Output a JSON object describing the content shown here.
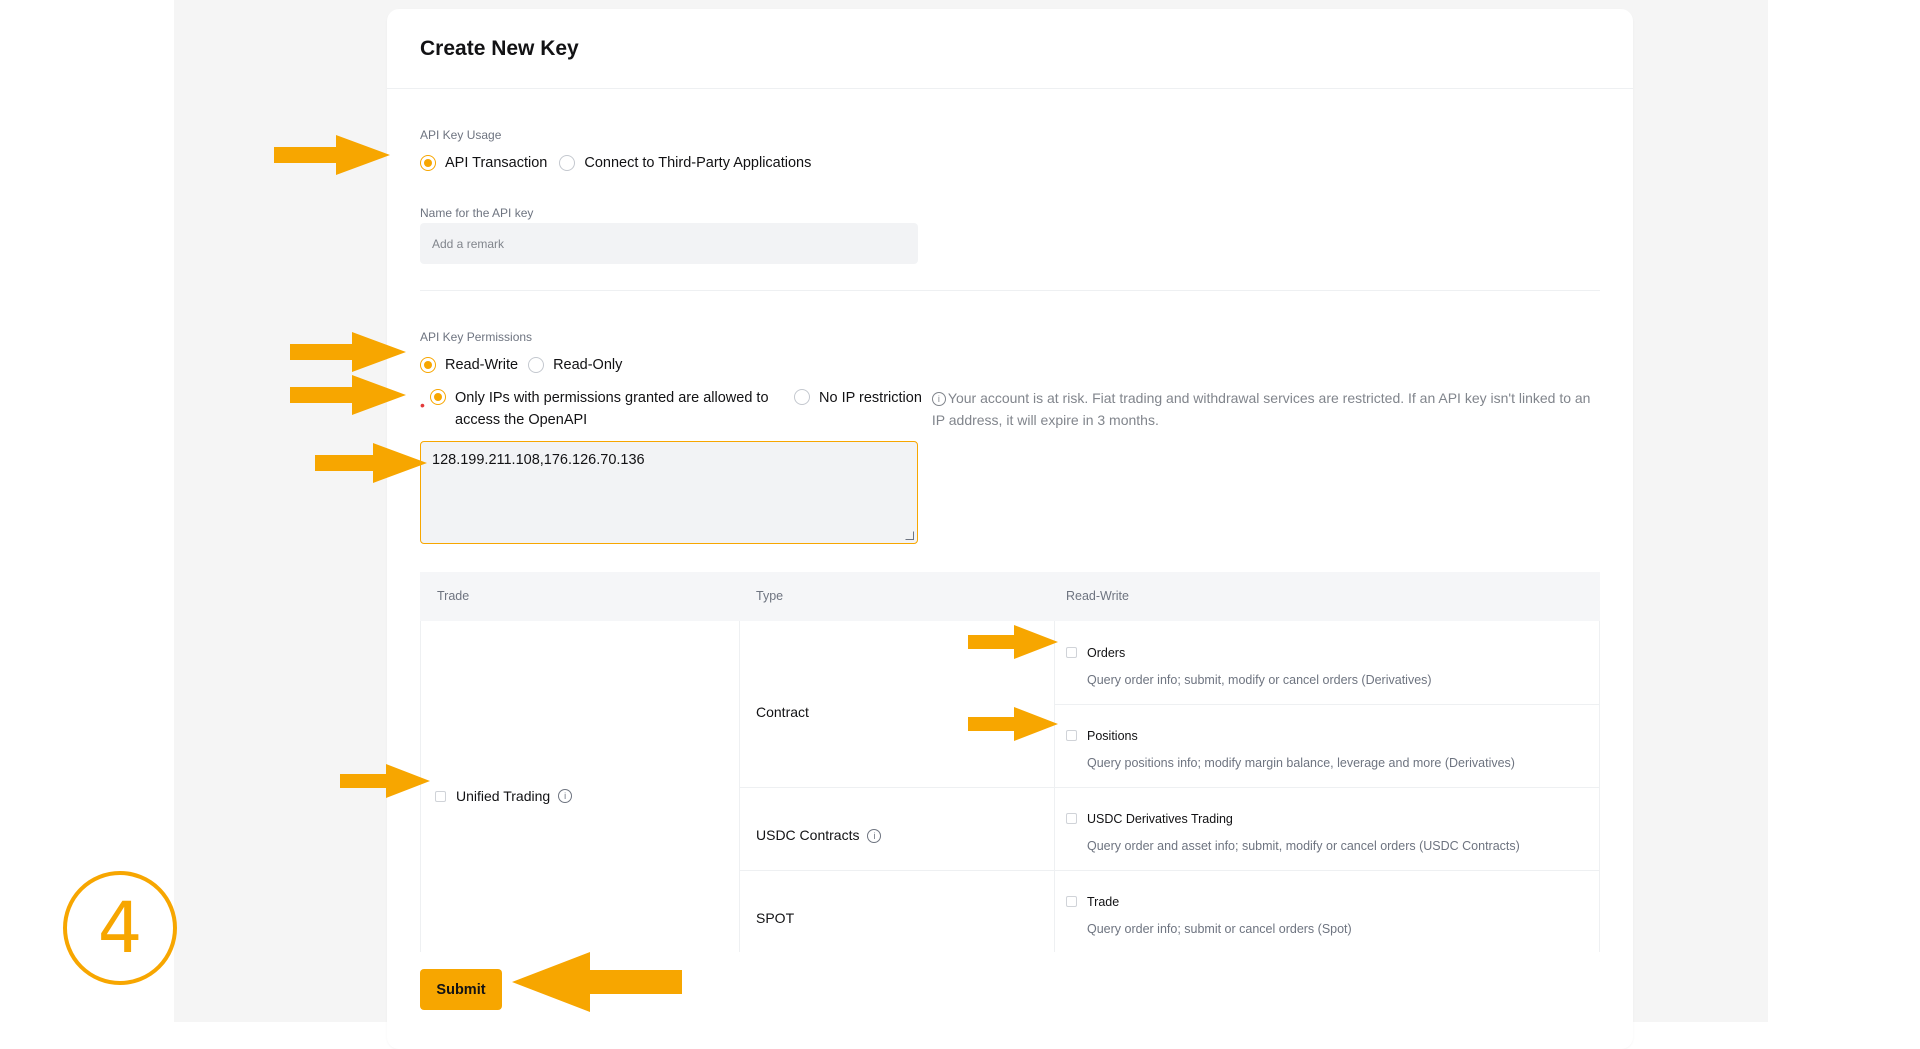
{
  "page_title": "Create New Key",
  "usage": {
    "label": "API Key Usage",
    "options": [
      "API Transaction",
      "Connect to Third-Party Applications"
    ],
    "selected": "API Transaction"
  },
  "name_field": {
    "label": "Name for the API key",
    "placeholder": "Add a remark"
  },
  "permissions": {
    "label": "API Key Permissions",
    "options": [
      "Read-Write",
      "Read-Only"
    ],
    "selected": "Read-Write"
  },
  "ip_restriction": {
    "option_restricted": "Only IPs with permissions granted are allowed to access the OpenAPI",
    "option_unrestricted": "No IP restriction",
    "warning": "Your account is at risk. Fiat trading and withdrawal services are restricted. If an API key isn't linked to an IP address, it will expire in 3 months.",
    "ip_value": "128.199.211.108,176.126.70.136"
  },
  "table": {
    "headers": [
      "Trade",
      "Type",
      "Read-Write"
    ],
    "trade_name": "Unified Trading",
    "types": {
      "contract": "Contract",
      "usdc": "USDC Contracts",
      "spot": "SPOT"
    },
    "permissions": [
      {
        "name": "Orders",
        "desc": "Query order info; submit, modify or cancel orders (Derivatives)"
      },
      {
        "name": "Positions",
        "desc": "Query positions info; modify margin balance, leverage and more (Derivatives)"
      },
      {
        "name": "USDC Derivatives Trading",
        "desc": "Query order and asset info; submit, modify or cancel orders (USDC Contracts)"
      },
      {
        "name": "Trade",
        "desc": "Query order info; submit or cancel orders (Spot)"
      }
    ]
  },
  "submit_label": "Submit",
  "step_number": "4",
  "colors": {
    "accent": "#f7a600",
    "arrow": "#f7a600",
    "text": "#121214",
    "muted": "#81858c"
  },
  "icons": [
    "info-icon",
    "arrow-right-icon",
    "arrow-left-icon",
    "step-circle-icon"
  ]
}
